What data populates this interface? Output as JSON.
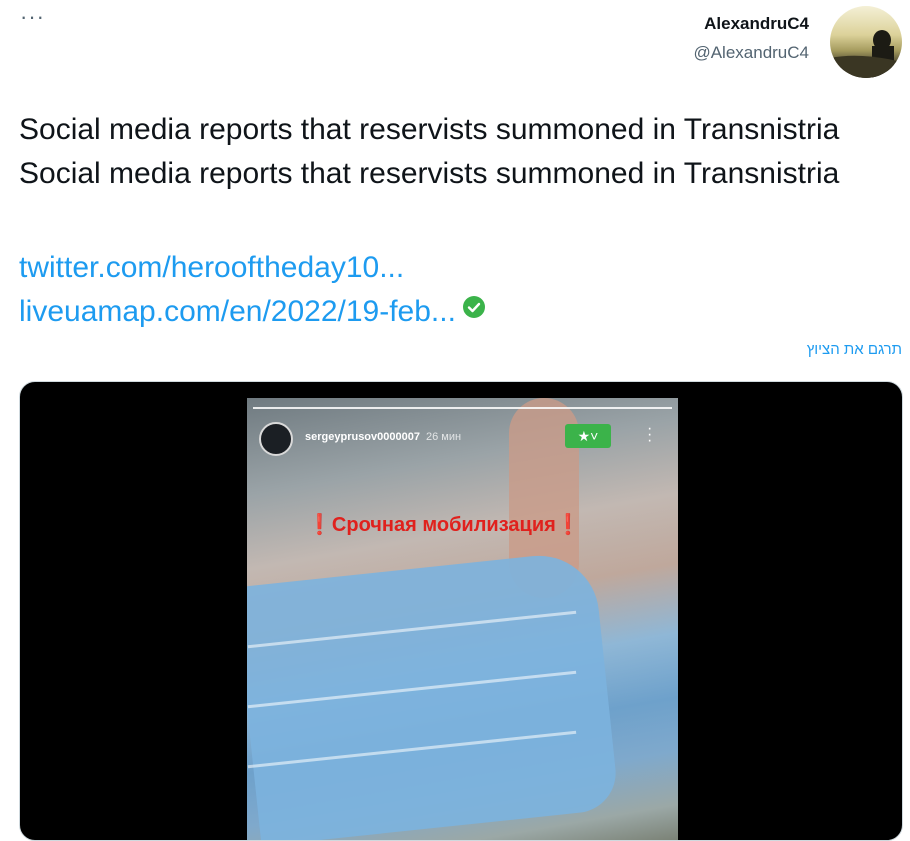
{
  "tweet": {
    "more_label": "···",
    "author_name": "AlexandruC4",
    "author_handle": "@AlexandruC4",
    "text": "Social media reports that reservists summoned in Transnistria Social media reports that reservists summoned in Transnistria",
    "links": [
      "twitter.com/herooftheday10...",
      "liveuamap.com/en/2022/19-feb..."
    ],
    "translate_label": "תרגם את הציוץ"
  },
  "media": {
    "story_username": "sergeyprusov0000007",
    "story_time": "26 мин",
    "star_label": "★˅",
    "overlay_text": "❗Срочная мобилизация❗"
  },
  "icons": {
    "more": "more-icon",
    "verified_check": "check-circle-icon",
    "kebab": "vertical-dots-icon"
  },
  "colors": {
    "link": "#1d9bf0",
    "check_green": "#3bb34a",
    "overlay_red": "#e0211d"
  }
}
